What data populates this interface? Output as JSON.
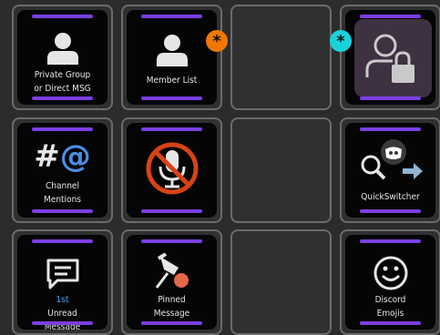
{
  "grid": {
    "cells": [
      {
        "label_lines": [
          "Private Group",
          "or Direct MSG"
        ],
        "icon": "person-icon"
      },
      {
        "label_lines": [
          "Member List"
        ],
        "icon": "person-icon"
      },
      {
        "empty": true
      },
      {
        "label_lines": [],
        "icon": "person-lock-icon"
      },
      {
        "label_lines": [
          "Channel",
          "Mentions"
        ],
        "icon": "hash-at-icon",
        "icon_text": {
          "hash": "#",
          "at": "@"
        }
      },
      {
        "label_lines": [],
        "icon": "muted-microphone-icon"
      },
      {
        "empty": true
      },
      {
        "label_lines": [
          "QuickSwitcher"
        ],
        "icon": "search-discord-arrow-icon"
      },
      {
        "label_lines": [
          "Unread",
          "Message"
        ],
        "label_prefix": "1st",
        "icon": "message-icon"
      },
      {
        "label_lines": [
          "Pinned",
          "Message"
        ],
        "icon": "pin-icon"
      },
      {
        "empty": true
      },
      {
        "label_lines": [
          "Discord",
          "Emojis"
        ],
        "icon": "smiley-icon"
      }
    ]
  },
  "badges": [
    {
      "symbol": "*",
      "color": "#f07800"
    },
    {
      "symbol": "*",
      "color": "#19d3dc"
    }
  ],
  "colors": {
    "accent_bar": "#7b3fe4",
    "key_face": "#050505",
    "slot_border": "#6b6b6b",
    "background": "#2c2c2c",
    "mention_at": "#4d8ee8",
    "prefix_highlight": "#4ba0e8",
    "mute_slash": "#d84315",
    "selected_key_face": "#3e3142"
  }
}
